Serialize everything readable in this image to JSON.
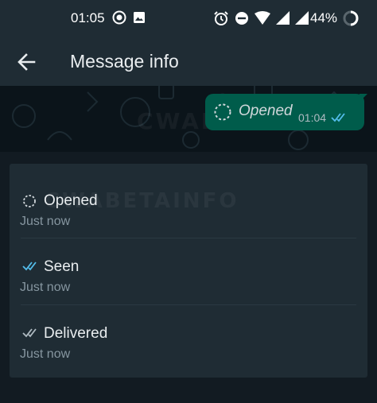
{
  "status_bar": {
    "time": "01:05",
    "battery": "44%",
    "icons": [
      "record-icon",
      "image-icon",
      "alarm-icon",
      "do-not-disturb-icon",
      "wifi-icon",
      "signal-icon",
      "signal-icon",
      "battery-saver-icon"
    ]
  },
  "app_bar": {
    "title": "Message info",
    "back_icon": "arrow-back-icon"
  },
  "message": {
    "text": "Opened",
    "time": "01:04",
    "status_icon": "view-once-icon",
    "ticks_icon": "double-check-icon",
    "ticks_color": "#53bdeb"
  },
  "receipts": [
    {
      "label": "Opened",
      "time": "Just now",
      "icon": "view-once-icon"
    },
    {
      "label": "Seen",
      "time": "Just now",
      "icon": "double-check-blue-icon"
    },
    {
      "label": "Delivered",
      "time": "Just now",
      "icon": "double-check-grey-icon"
    }
  ],
  "watermark": "CWABETAINFO",
  "colors": {
    "background": "#121b22",
    "app_bar": "#1f2c34",
    "bubble": "#005c4b",
    "card": "#1f2c34",
    "read_blue": "#53bdeb",
    "secondary_text": "#8696a0"
  }
}
